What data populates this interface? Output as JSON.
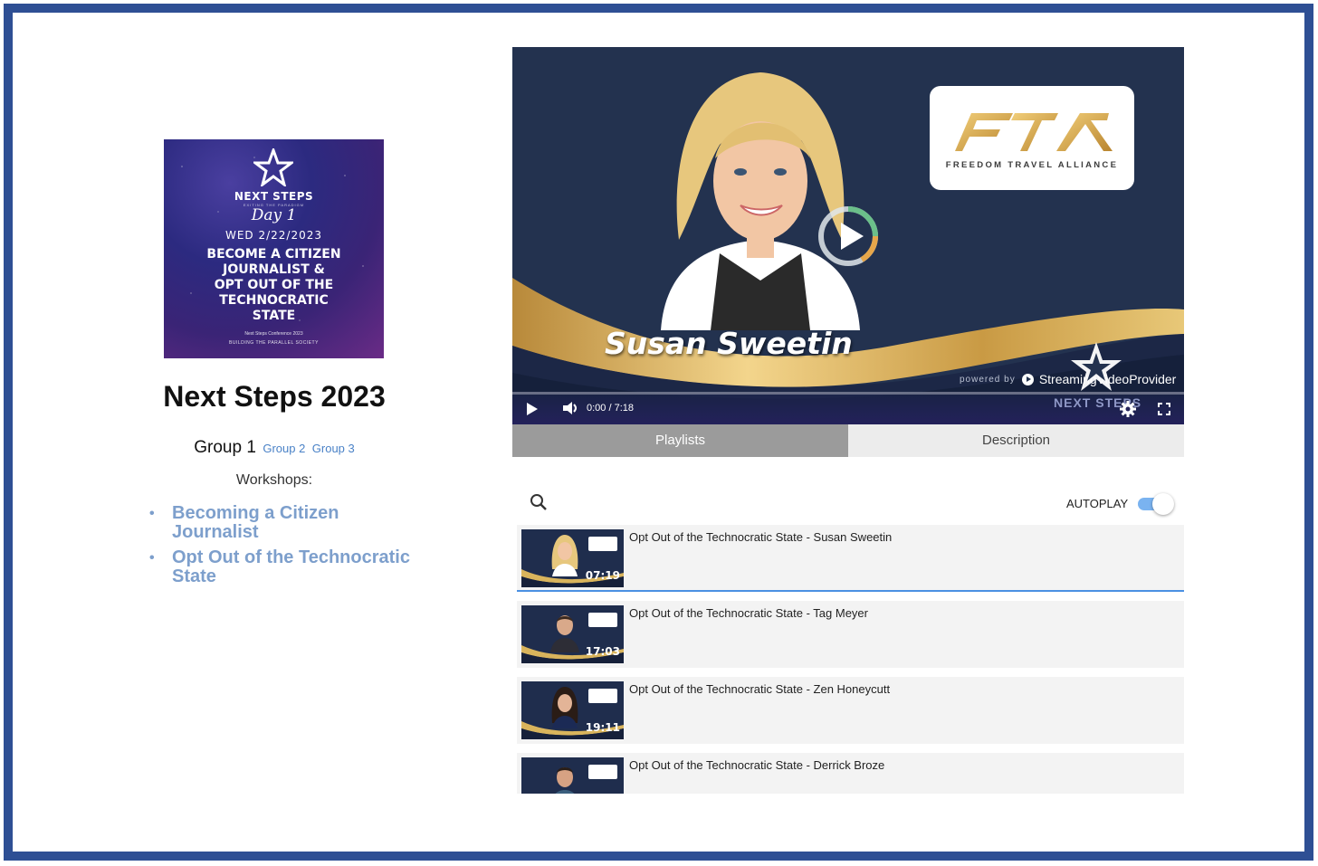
{
  "poster": {
    "brand": "NEXT STEPS",
    "tagline": "EXITING THE PARADIGM",
    "day": "Day 1",
    "date": "WED 2/22/2023",
    "title_lines": [
      "BECOME A CITIZEN",
      "JOURNALIST &",
      "OPT OUT OF THE",
      "TECHNOCRATIC",
      "STATE"
    ],
    "footer1": "Next Steps Conference 2023",
    "footer2": "BUILDING THE PARALLEL SOCIETY"
  },
  "event": {
    "title": "Next Steps 2023",
    "current_group": "Group 1",
    "group_links": [
      "Group 2",
      "Group 3"
    ],
    "workshops_label": "Workshops:",
    "workshops": [
      "Becoming a Citizen Journalist",
      "Opt Out of the Technocratic State"
    ]
  },
  "player": {
    "speaker_name": "Susan Sweetin",
    "logo_text": "FREEDOM TRAVEL ALLIANCE",
    "powered_by": "powered by",
    "provider": "StreamingVideoProvider",
    "time": "0:00 / 7:18",
    "progress": 0,
    "watermark": "NEXT STEPS"
  },
  "tabs": [
    {
      "label": "Playlists",
      "active": true
    },
    {
      "label": "Description",
      "active": false
    }
  ],
  "playlist": {
    "autoplay_label": "AUTOPLAY",
    "autoplay_on": true,
    "items": [
      {
        "title": "Opt Out of the Technocratic State - Susan Sweetin",
        "duration": "07:19",
        "current": true
      },
      {
        "title": "Opt Out of the Technocratic State - Tag Meyer",
        "duration": "17:03",
        "current": false
      },
      {
        "title": "Opt Out of the Technocratic State - Zen Honeycutt",
        "duration": "19:11",
        "current": false
      },
      {
        "title": "Opt Out of the Technocratic State - Derrick Broze",
        "duration": "",
        "current": false
      }
    ]
  },
  "colors": {
    "frame": "#2e4f94",
    "link": "#4a82c7",
    "workshop_link": "#7d9fcc",
    "player_bg": "#23324f",
    "gold": "#d4a94a",
    "toggle": "#7ab3f0"
  }
}
